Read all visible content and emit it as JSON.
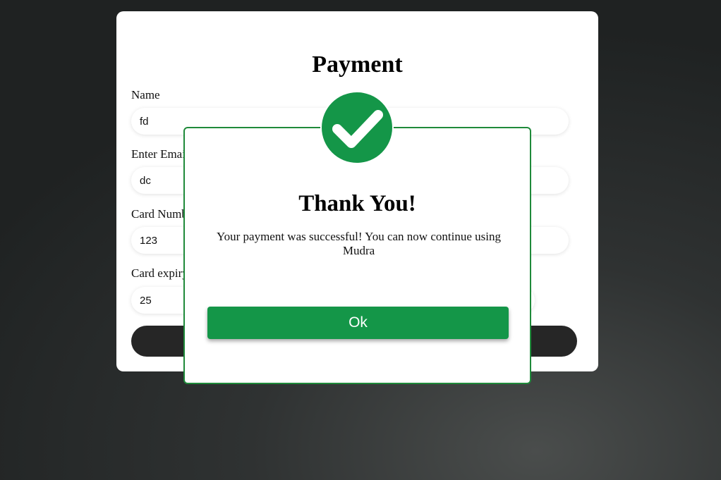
{
  "form": {
    "title": "Payment",
    "fields": [
      {
        "label": "Name",
        "value": "fd"
      },
      {
        "label": "Enter Email",
        "value": "dc"
      },
      {
        "label": "Card Number",
        "value": "123"
      },
      {
        "label": "Card expiry",
        "value": "25"
      }
    ],
    "submit_label": ""
  },
  "modal": {
    "icon": "check-circle-icon",
    "title": "Thank You!",
    "message": "Your payment was successful! You can now continue using Mudra",
    "ok_label": "Ok",
    "accent_color": "#149648"
  },
  "colors": {
    "success_green": "#149648",
    "dark_button": "#262626"
  }
}
